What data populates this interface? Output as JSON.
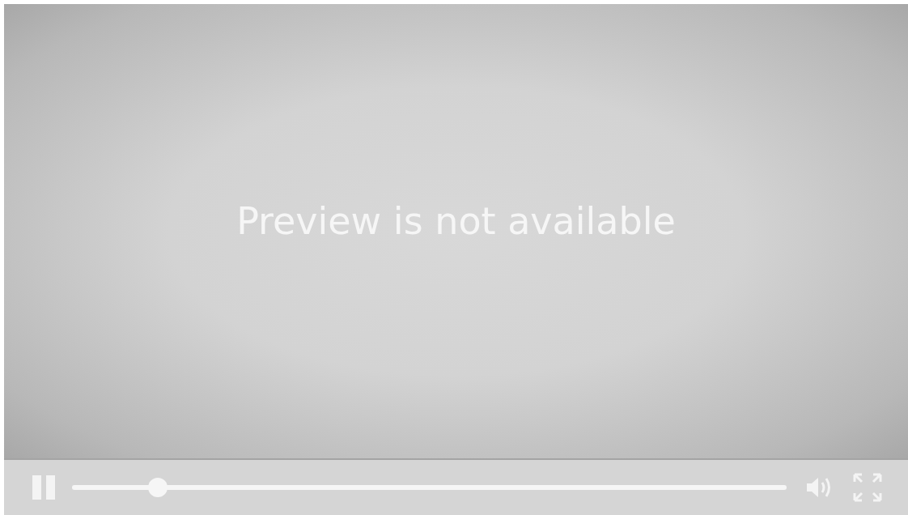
{
  "player": {
    "message": "Preview is not available",
    "playing": true,
    "seek": {
      "level": 0.12
    }
  }
}
